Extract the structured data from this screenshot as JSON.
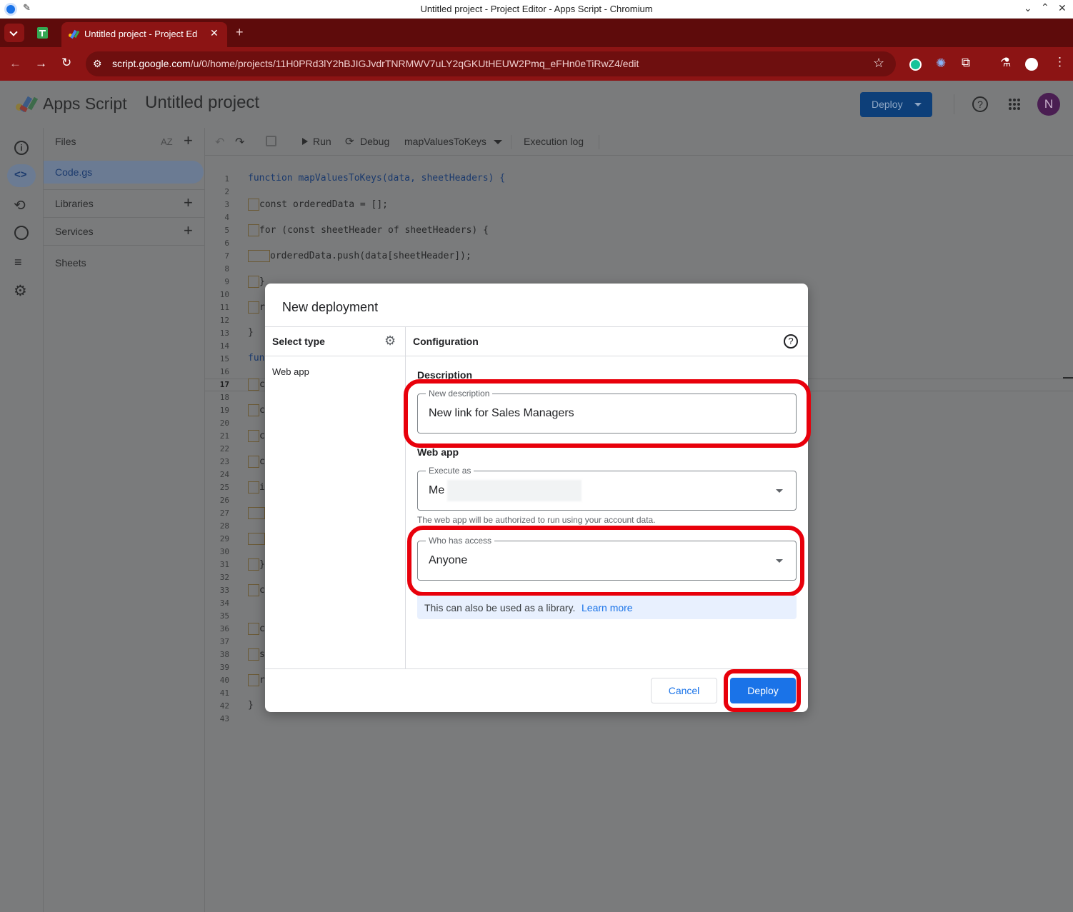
{
  "window": {
    "title": "Untitled project - Project Editor - Apps Script - Chromium"
  },
  "browser": {
    "tab_title": "Untitled project - Project Ed",
    "url_host": "script.google.com",
    "url_path": "/u/0/home/projects/11H0PRd3lY2hBJIGJvdrTNRMWV7uLY2qGKUtHEUW2Pmq_eFHn0eTiRwZ4/edit"
  },
  "app": {
    "brand": "Apps Script",
    "project_name": "Untitled project",
    "deploy_label": "Deploy",
    "avatar_initial": "N"
  },
  "files_panel": {
    "files_label": "Files",
    "file_name": "Code.gs",
    "libraries_label": "Libraries",
    "services_label": "Services",
    "sheets_label": "Sheets"
  },
  "editor_toolbar": {
    "run": "Run",
    "debug": "Debug",
    "function_name": "mapValuesToKeys",
    "execution_log": "Execution log"
  },
  "code": {
    "line_numbers": [
      "1",
      "2",
      "3",
      "4",
      "5",
      "6",
      "7",
      "8",
      "9",
      "10",
      "11",
      "12",
      "13",
      "14",
      "15",
      "16",
      "17",
      "18",
      "19",
      "20",
      "21",
      "22",
      "23",
      "24",
      "25",
      "26",
      "27",
      "28",
      "29",
      "30",
      "31",
      "32",
      "33",
      "34",
      "35",
      "36",
      "37",
      "38",
      "39",
      "40",
      "41",
      "42",
      "43"
    ],
    "line1": "function mapValuesToKeys(data, sheetHeaders) {",
    "line3": "const orderedData = [];",
    "line5": "for (const sheetHeader of sheetHeaders) {",
    "line7": "orderedData.push(data[sheetHeader]);",
    "line9": "}",
    "line11": "r",
    "line13": "}",
    "line15": "fun",
    "line17": "c",
    "line19": "c",
    "line21": "c",
    "line23": "c",
    "line25": "i",
    "line31": "}",
    "line33": "c",
    "line36": "c",
    "line38": "s",
    "line40": "r",
    "line42": "}"
  },
  "dialog": {
    "title": "New deployment",
    "select_type": "Select type",
    "type_item": "Web app",
    "configuration": "Configuration",
    "description_heading": "Description",
    "description_label": "New description",
    "description_value": "New link for Sales Managers",
    "webapp_heading": "Web app",
    "execute_as_label": "Execute as",
    "execute_as_value": "Me",
    "execute_as_hint": "The web app will be authorized to run using your account data.",
    "access_label": "Who has access",
    "access_value": "Anyone",
    "library_note": "This can also be used as a library.",
    "learn_more": "Learn more",
    "cancel": "Cancel",
    "deploy": "Deploy"
  },
  "colors": {
    "highlight": "#e8000b",
    "primary": "#1a73e8",
    "browser_frame": "#8c1414"
  }
}
